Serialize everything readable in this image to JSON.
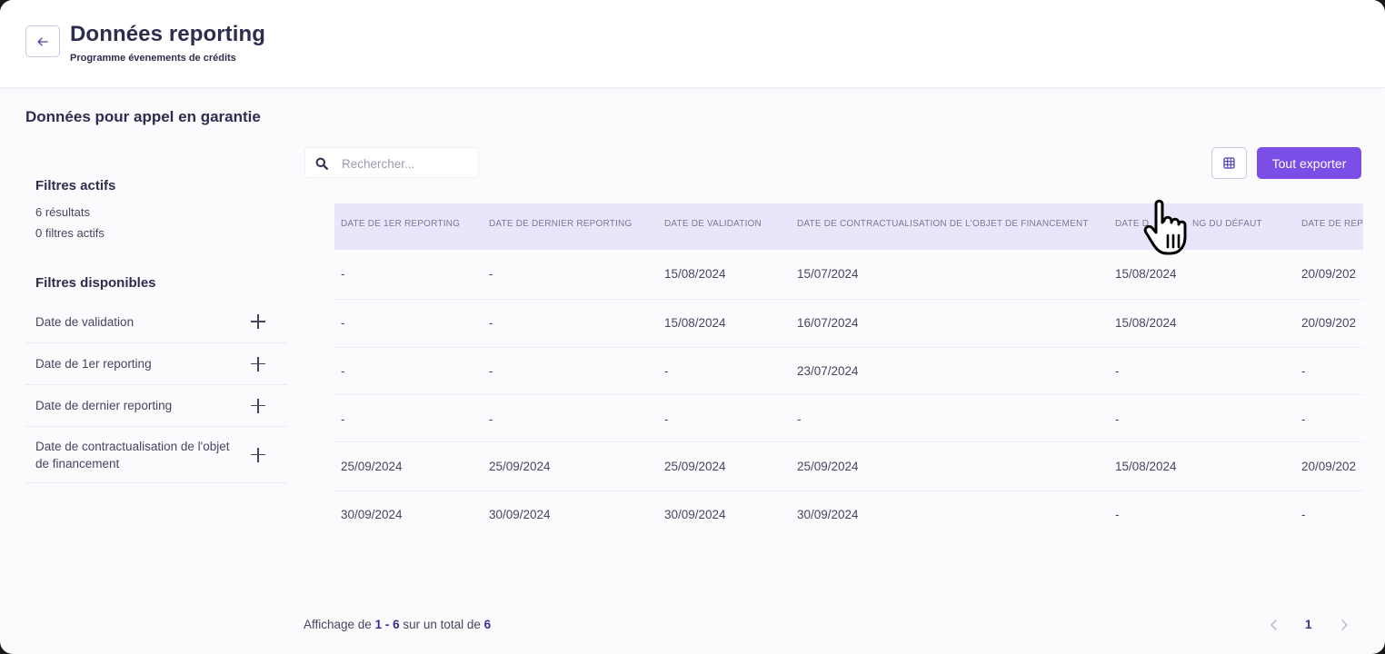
{
  "header": {
    "title": "Données reporting",
    "subtitle": "Programme évenements de crédits"
  },
  "section": {
    "title": "Données pour appel en garantie"
  },
  "sidebar": {
    "active_heading": "Filtres actifs",
    "results": "6 résultats",
    "active_filters": "0 filtres actifs",
    "available_heading": "Filtres disponibles",
    "filters": [
      "Date de validation",
      "Date de 1er reporting",
      "Date de dernier reporting",
      "Date de contractualisation de l'objet de financement"
    ]
  },
  "search": {
    "placeholder": "Rechercher..."
  },
  "toolbar": {
    "export_label": "Tout exporter"
  },
  "table": {
    "headers": [
      "Date de 1er reporting",
      "Date de dernier reporting",
      "Date de validation",
      "Date de contractualisation de l'objet de financement",
      "Date de passage en dépôt du défaut",
      "Date de rep"
    ],
    "header_visible": [
      "Date de 1er reporting",
      "Date de dernier reporting",
      "Date de validation",
      "Date de contractualisation de l'objet de financement",
      "Date d",
      "ng du défaut",
      "Date de rep"
    ],
    "rows": [
      [
        "-",
        "-",
        "15/08/2024",
        "15/07/2024",
        "15/08/2024",
        "20/09/202"
      ],
      [
        "-",
        "-",
        "15/08/2024",
        "16/07/2024",
        "15/08/2024",
        "20/09/202"
      ],
      [
        "-",
        "-",
        "-",
        "23/07/2024",
        "-",
        "-"
      ],
      [
        "-",
        "-",
        "-",
        "-",
        "-",
        "-"
      ],
      [
        "25/09/2024",
        "25/09/2024",
        "25/09/2024",
        "25/09/2024",
        "15/08/2024",
        "20/09/202"
      ],
      [
        "30/09/2024",
        "30/09/2024",
        "30/09/2024",
        "30/09/2024",
        "-",
        "-"
      ]
    ]
  },
  "footer": {
    "prefix": "Affichage de ",
    "range": "1 - 6",
    "middle": " sur un total de ",
    "total": "6"
  },
  "pagination": {
    "current_page": "1"
  },
  "colors": {
    "accent": "#7b4ee8",
    "header_bg": "#e9e6fb",
    "page_bg": "#fbfbfe"
  }
}
